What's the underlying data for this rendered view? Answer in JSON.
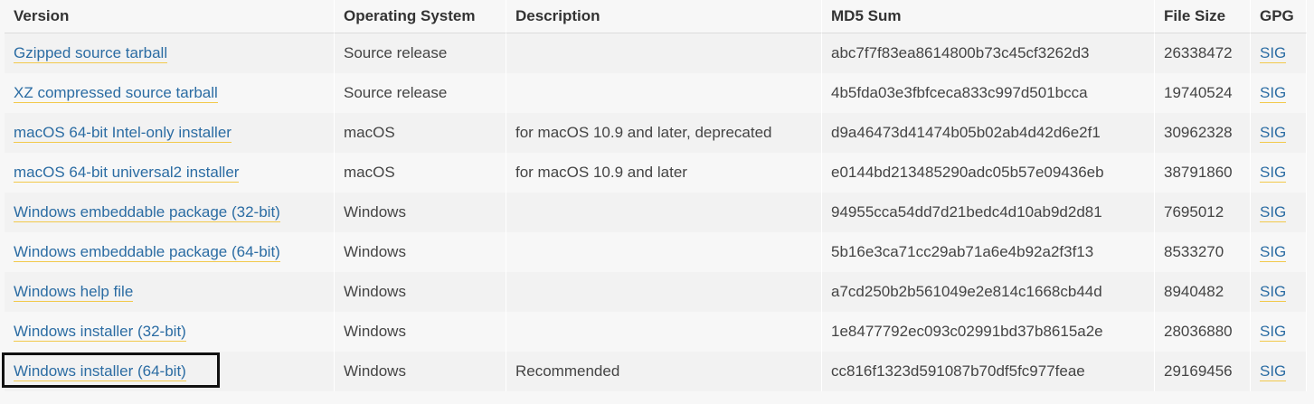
{
  "table": {
    "headers": {
      "version": "Version",
      "os": "Operating System",
      "description": "Description",
      "md5": "MD5 Sum",
      "size": "File Size",
      "gpg": "GPG"
    },
    "rows": [
      {
        "version": "Gzipped source tarball",
        "os": "Source release",
        "description": "",
        "md5": "abc7f7f83ea8614800b73c45cf3262d3",
        "size": "26338472",
        "gpg": "SIG"
      },
      {
        "version": "XZ compressed source tarball",
        "os": "Source release",
        "description": "",
        "md5": "4b5fda03e3fbfceca833c997d501bcca",
        "size": "19740524",
        "gpg": "SIG"
      },
      {
        "version": "macOS 64-bit Intel-only installer",
        "os": "macOS",
        "description": "for macOS 10.9 and later, deprecated",
        "md5": "d9a46473d41474b05b02ab4d42d6e2f1",
        "size": "30962328",
        "gpg": "SIG"
      },
      {
        "version": "macOS 64-bit universal2 installer",
        "os": "macOS",
        "description": "for macOS 10.9 and later",
        "md5": "e0144bd213485290adc05b57e09436eb",
        "size": "38791860",
        "gpg": "SIG"
      },
      {
        "version": "Windows embeddable package (32-bit)",
        "os": "Windows",
        "description": "",
        "md5": "94955cca54dd7d21bedc4d10ab9d2d81",
        "size": "7695012",
        "gpg": "SIG"
      },
      {
        "version": "Windows embeddable package (64-bit)",
        "os": "Windows",
        "description": "",
        "md5": "5b16e3ca71cc29ab71a6e4b92a2f3f13",
        "size": "8533270",
        "gpg": "SIG"
      },
      {
        "version": "Windows help file",
        "os": "Windows",
        "description": "",
        "md5": "a7cd250b2b561049e2e814c1668cb44d",
        "size": "8940482",
        "gpg": "SIG"
      },
      {
        "version": "Windows installer (32-bit)",
        "os": "Windows",
        "description": "",
        "md5": "1e8477792ec093c02991bd37b8615a2e",
        "size": "28036880",
        "gpg": "SIG"
      },
      {
        "version": "Windows installer (64-bit)",
        "os": "Windows",
        "description": "Recommended",
        "md5": "cc816f1323d591087b70df5fc977feae",
        "size": "29169456",
        "gpg": "SIG"
      }
    ]
  },
  "colors": {
    "link": "#2b6ca3",
    "link_underline": "#f2c94c",
    "highlight_border": "#111111"
  }
}
